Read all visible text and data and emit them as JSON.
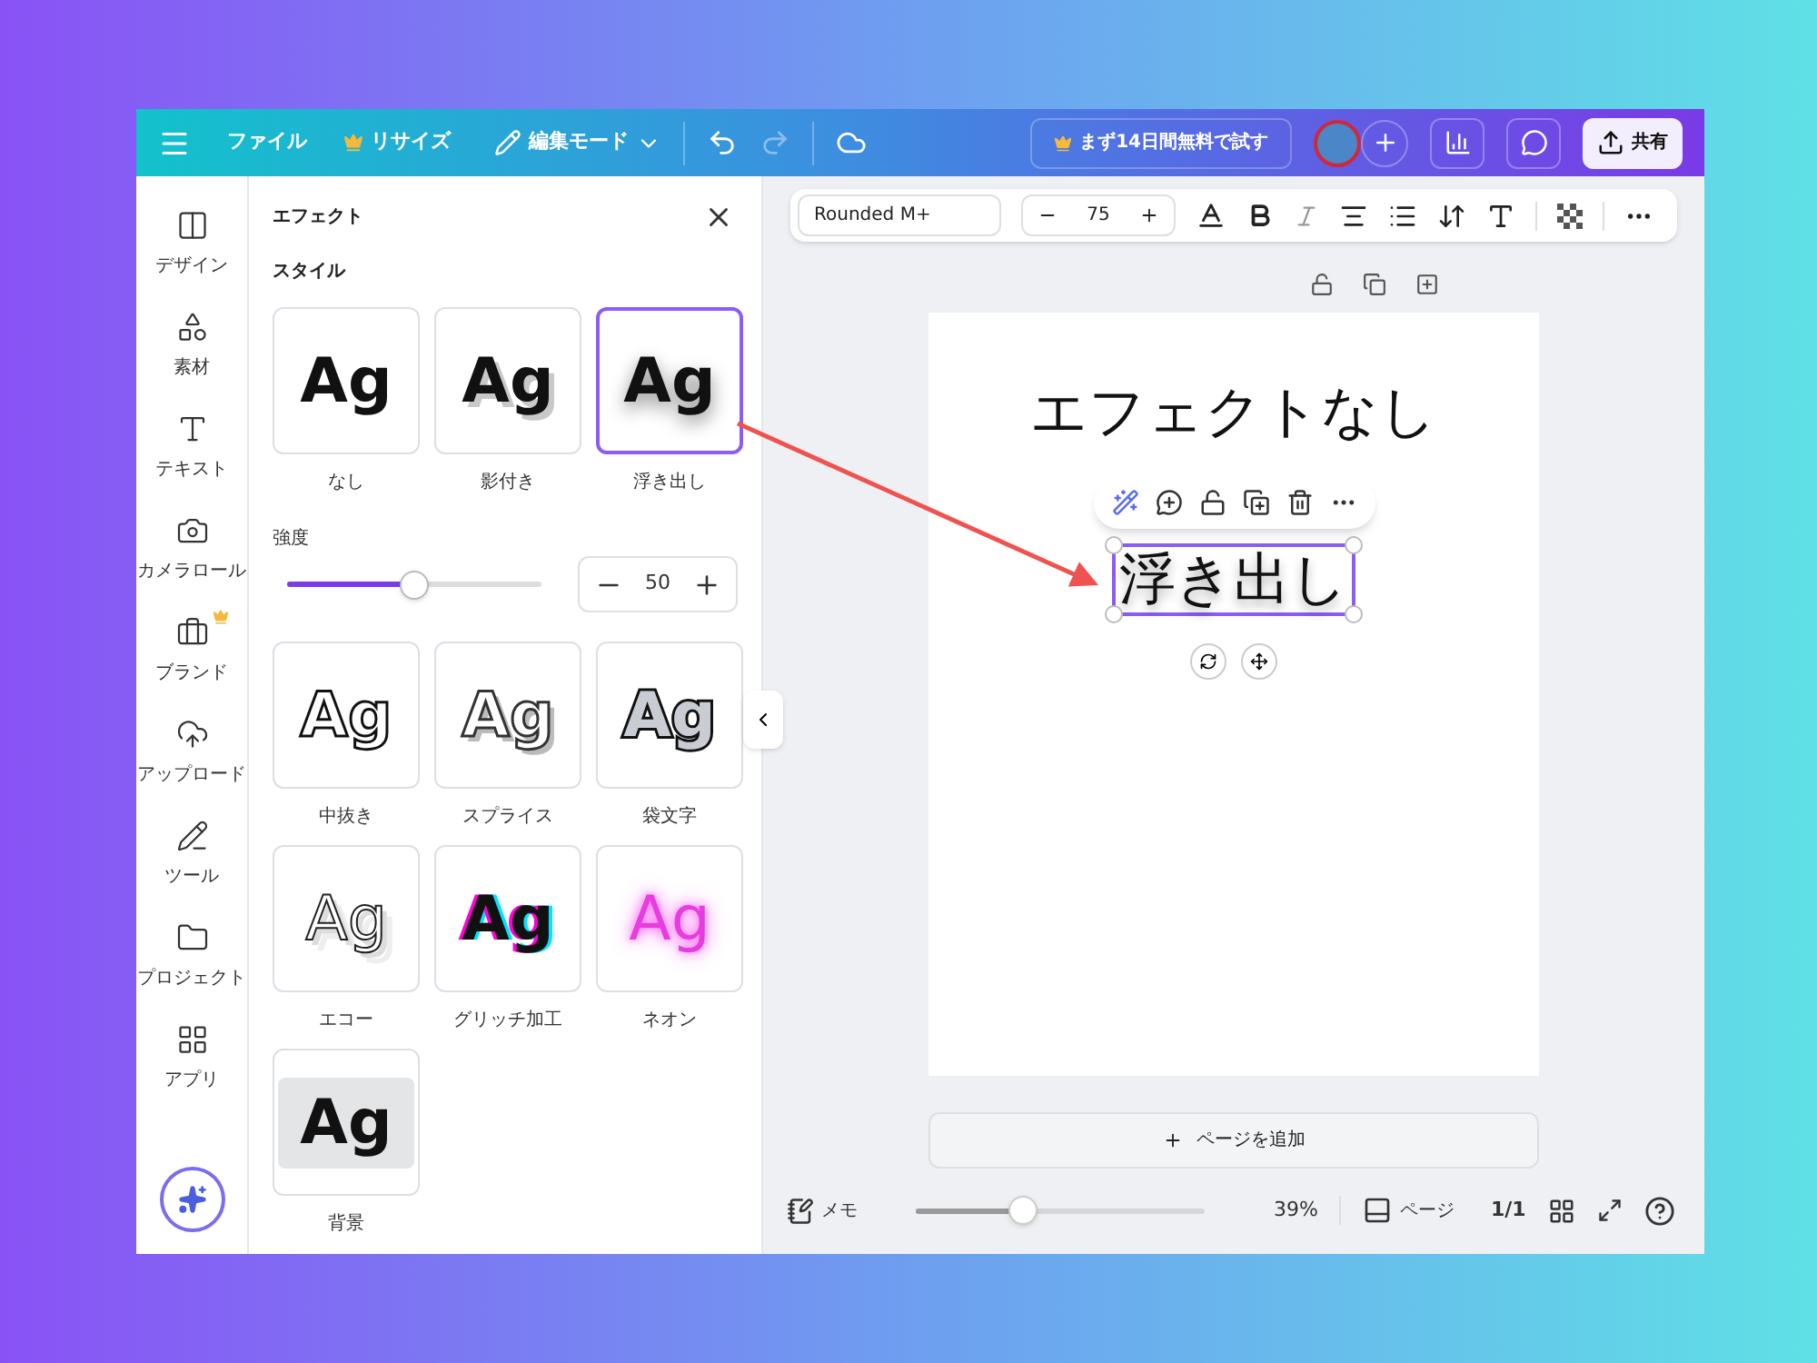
{
  "topbar": {
    "menu": "ファイル",
    "resize": "リサイズ",
    "mode": "編集モード",
    "trial": "まず14日間無料で試す",
    "share": "共有"
  },
  "rail": [
    {
      "label": "デザイン",
      "kind": "design",
      "premium": false
    },
    {
      "label": "素材",
      "kind": "elements",
      "premium": false
    },
    {
      "label": "テキスト",
      "kind": "text",
      "premium": false
    },
    {
      "label": "カメラロール",
      "kind": "camera",
      "premium": false
    },
    {
      "label": "ブランド",
      "kind": "brand",
      "premium": true
    },
    {
      "label": "アップロード",
      "kind": "upload",
      "premium": false
    },
    {
      "label": "ツール",
      "kind": "tools",
      "premium": false
    },
    {
      "label": "プロジェクト",
      "kind": "projects",
      "premium": false
    },
    {
      "label": "アプリ",
      "kind": "apps",
      "premium": false
    }
  ],
  "panel": {
    "title": "エフェクト",
    "section": "スタイル",
    "styles": [
      {
        "label": "なし",
        "preview": "Ag",
        "kind": "none",
        "selected": false
      },
      {
        "label": "影付き",
        "preview": "Ag",
        "kind": "shadow",
        "selected": false
      },
      {
        "label": "浮き出し",
        "preview": "Ag",
        "kind": "lift",
        "selected": true
      },
      {
        "label": "中抜き",
        "preview": "Ag",
        "kind": "hollow",
        "selected": false
      },
      {
        "label": "スプライス",
        "preview": "Ag",
        "kind": "splice",
        "selected": false
      },
      {
        "label": "袋文字",
        "preview": "Ag",
        "kind": "outline",
        "selected": false
      },
      {
        "label": "エコー",
        "preview": "Ag",
        "kind": "echo",
        "selected": false
      },
      {
        "label": "グリッチ加工",
        "preview": "Ag",
        "kind": "glitch",
        "selected": false
      },
      {
        "label": "ネオン",
        "preview": "Ag",
        "kind": "neon",
        "selected": false
      },
      {
        "label": "背景",
        "preview": "Ag",
        "kind": "background",
        "selected": false
      }
    ],
    "intensity": {
      "label": "強度",
      "level": 0.5,
      "value": "50"
    }
  },
  "toolbar": {
    "font": "Rounded M+",
    "size": "75"
  },
  "canvas": {
    "heading": "エフェクトなし",
    "selected_text": "浮き出し"
  },
  "add_page": "ページを追加",
  "footer": {
    "notes": "メモ",
    "zoom": {
      "level": 0.37,
      "reading": "39%"
    },
    "pages": "ページ",
    "page_count": "1/1"
  }
}
